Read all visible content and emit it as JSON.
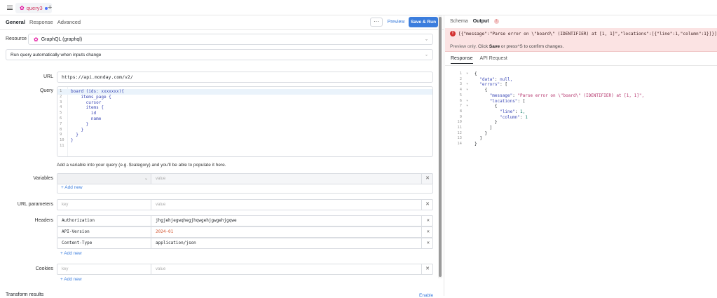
{
  "topbar": {
    "tab_label": "query3",
    "add_tab": "+"
  },
  "left": {
    "subtabs": [
      "General",
      "Response",
      "Advanced"
    ],
    "more_label": "···",
    "preview_label": "Preview",
    "save_run_label": "Save & Run",
    "resource_label": "Resource",
    "resource_value": "GraphQL (graphql)",
    "run_auto_label": "Run query automatically when inputs change",
    "url_label": "URL",
    "url_value": "https://api.monday.com/v2/",
    "query_label": "Query",
    "query_lines": [
      {
        "n": "1",
        "text": "board (ids: xxxxxxx){"
      },
      {
        "n": "2",
        "text": "    items_page {"
      },
      {
        "n": "3",
        "text": "      cursor"
      },
      {
        "n": "4",
        "text": "      items {"
      },
      {
        "n": "5",
        "text": "        id"
      },
      {
        "n": "6",
        "text": "        name"
      },
      {
        "n": "7",
        "text": "      }"
      },
      {
        "n": "8",
        "text": "    }"
      },
      {
        "n": "9",
        "text": "  }"
      },
      {
        "n": "10",
        "text": "}"
      },
      {
        "n": "11",
        "text": ""
      }
    ],
    "helper_text": "Add a variable into your query (e.g. $category) and you'll be able to populate it here.",
    "variables_label": "Variables",
    "variables_value_placeholder": "value",
    "url_params_label": "URL parameters",
    "key_placeholder": "key",
    "value_placeholder": "value",
    "headers_label": "Headers",
    "headers": [
      {
        "key": "Authorization",
        "value": "jhgjehjegwqhegjhqwgehjgwgehjgqwe"
      },
      {
        "key": "API-Version",
        "value": "2024-01"
      },
      {
        "key": "Content-Type",
        "value": "application/json"
      }
    ],
    "cookies_label": "Cookies",
    "add_new_label": "Add new",
    "transform_results_label": "Transform results",
    "enable_label": "Enable"
  },
  "right": {
    "schema_tab": "Schema",
    "output_tab": "Output",
    "error_message": "[{\"message\":\"Parse error on \\\"board\\\" (IDENTIFIER) at [1, 1]\",\"locations\":[{\"line\":1,\"column\":1}]}]",
    "preview_only": "Preview only.",
    "preview_click": "Click",
    "preview_save": "Save",
    "preview_rest": "or press^S to confirm changes.",
    "response_tab": "Response",
    "api_request_tab": "API Request",
    "json_lines": [
      {
        "n": "1",
        "text": "{"
      },
      {
        "n": "2",
        "text": "  \"data\": null,"
      },
      {
        "n": "3",
        "text": "  \"errors\": ["
      },
      {
        "n": "4",
        "text": "    {"
      },
      {
        "n": "5",
        "text": "      \"message\": \"Parse error on \\\"board\\\" (IDENTIFIER) at [1, 1]\","
      },
      {
        "n": "6",
        "text": "      \"locations\": ["
      },
      {
        "n": "7",
        "text": "        {"
      },
      {
        "n": "8",
        "text": "          \"line\": 1,"
      },
      {
        "n": "9",
        "text": "          \"column\": 1"
      },
      {
        "n": "10",
        "text": "        }"
      },
      {
        "n": "11",
        "text": "      ]"
      },
      {
        "n": "12",
        "text": "    }"
      },
      {
        "n": "13",
        "text": "  ]"
      },
      {
        "n": "14",
        "text": "}"
      }
    ]
  }
}
